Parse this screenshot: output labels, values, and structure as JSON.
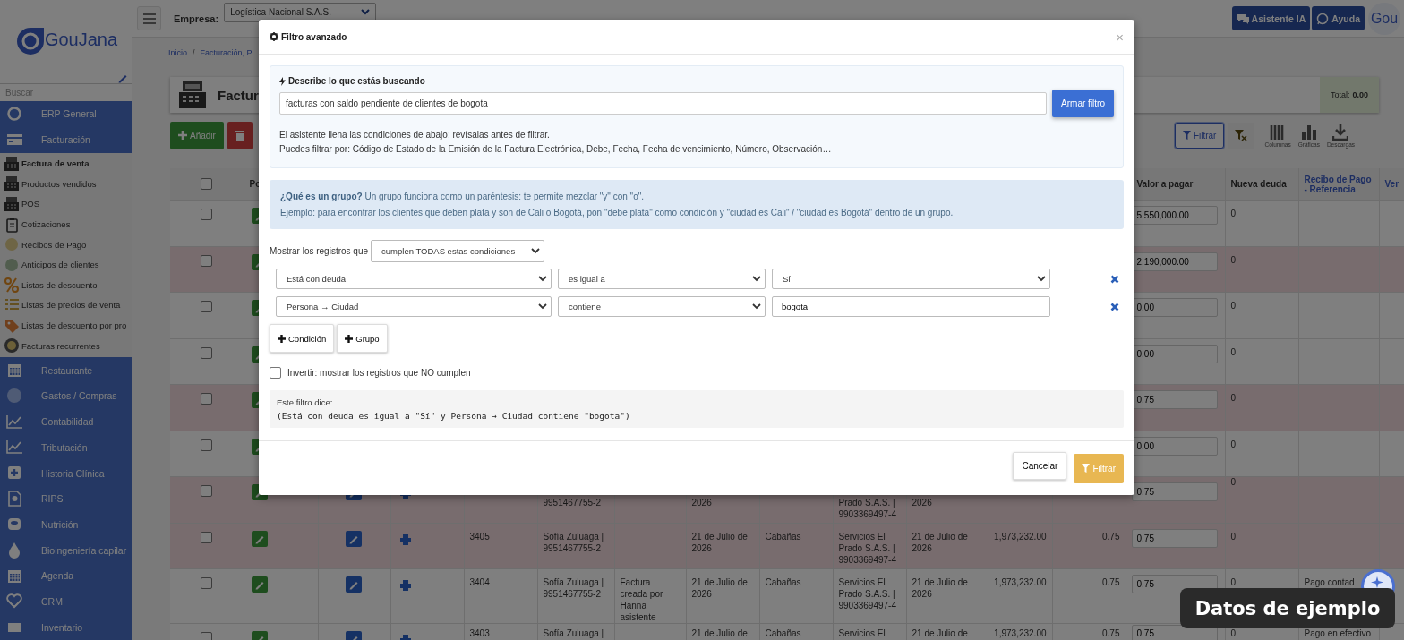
{
  "topbar": {
    "company_label": "Empresa:",
    "company": "Logística Nacional S.A.S.",
    "buttons": [
      "Asistente IA",
      "Ayuda"
    ],
    "avatar": "Gou"
  },
  "sidebar": {
    "logo": "GouJana",
    "search": {
      "placeholder": "Buscar"
    },
    "items": [
      {
        "label": "ERP General",
        "selected": false
      },
      {
        "label": "Facturación",
        "selected": false,
        "expanded": true,
        "children": [
          {
            "label": "Factura de venta",
            "selected": true
          },
          {
            "label": "Productos vendidos",
            "selected": false
          },
          {
            "label": "POS",
            "selected": false
          },
          {
            "label": "Cotizaciones",
            "selected": false
          },
          {
            "label": "Recibos de Pago",
            "selected": false
          },
          {
            "label": "Anticipos de clientes",
            "selected": false
          },
          {
            "label": "Listas de descuento",
            "selected": false
          },
          {
            "label": "Listas de precios de venta",
            "selected": false
          },
          {
            "label": "Listas de descuento por pro",
            "selected": false
          },
          {
            "label": "Facturas recurrentes",
            "selected": false
          }
        ]
      },
      {
        "label": "Restaurante",
        "selected": false
      },
      {
        "label": "Gastos / Compras",
        "selected": false
      },
      {
        "label": "Contabilidad",
        "selected": false
      },
      {
        "label": "Tributación",
        "selected": false
      },
      {
        "label": "Historia Clínica",
        "selected": false
      },
      {
        "label": "RIPS",
        "selected": false
      },
      {
        "label": "Nutrición",
        "selected": false
      },
      {
        "label": "Bioingeniería capilar",
        "selected": false
      },
      {
        "label": "Agenda",
        "selected": false
      },
      {
        "label": "CRM",
        "selected": false
      },
      {
        "label": "Inventario",
        "selected": false
      }
    ]
  },
  "breadcrumb": {
    "items": [
      "Inicio",
      "Facturación, P"
    ],
    "separator": "/"
  },
  "page": {
    "title": "Factur",
    "total_label": "Total:",
    "total": "0.00"
  },
  "toolbar": {
    "add": "Añadir",
    "filter": {
      "label": "Filtrar",
      "active": true
    },
    "tools": [
      "Columnas",
      "Gráficas",
      "Descargas"
    ]
  },
  "table": {
    "select_all_checked": false,
    "header_left": "Po",
    "header_right": [
      "Valor a pagar",
      "Nueva deuda",
      "Recibo de Pago - Referencia",
      "Ver"
    ],
    "rows": [
      {
        "highlighted": false,
        "checked": false,
        "column_14": "5,550,000.00",
        "column_15": "0"
      },
      {
        "highlighted": true,
        "checked": false,
        "column_14": "2,190,000.00",
        "column_15": "0"
      },
      {
        "highlighted": false,
        "checked": false,
        "column_14": "0.00",
        "column_15": "0"
      },
      {
        "highlighted": false,
        "checked": false,
        "column_14": "0.00",
        "column_15": "0"
      },
      {
        "highlighted": true,
        "checked": false,
        "column_14": "0.75",
        "column_15": "0"
      },
      {
        "highlighted": false,
        "checked": false,
        "column_14": "0.00",
        "column_15": "0"
      },
      {
        "highlighted": true,
        "checked": false,
        "column_6": "9951467755-2",
        "column_8": "2026",
        "column_10": "Prado S.A.S. | 9903369497-4",
        "column_11": "2026",
        "column_14": "0.75",
        "column_15": "0"
      },
      {
        "highlighted": true,
        "checked": false,
        "column_5": "3405",
        "column_6": "Sofía Zuluaga | 9951467755-2",
        "column_8": "21 de Julio de 2026",
        "column_9": "Cabañas",
        "column_10": "Servicios El Prado S.A.S. | 9903369497-4",
        "column_11": "21 de Julio de 2026",
        "column_12": "1,973,232.00",
        "column_13": "0.75",
        "column_14": "0.75",
        "column_15": "0"
      },
      {
        "highlighted": false,
        "checked": false,
        "column_5": "3404",
        "column_6": "Sofía Zuluaga | 9951467755-2",
        "column_7": "Factura creada por Hanna asistente",
        "column_8": "21 de Julio de 2026",
        "column_9": "Cabañas",
        "column_10": "Servicios El Prado S.A.S. | 9903369497-4",
        "column_11": "21 de Julio de 2026",
        "column_12": "1,973,232.00",
        "column_13": "0.75",
        "column_14": "0.75",
        "column_15": "0",
        "column_16": "Pago contad"
      },
      {
        "highlighted": false,
        "checked": false,
        "column_5": "3403",
        "column_6": "Sofía Zuluaga |",
        "column_8": "21 de Julio de",
        "column_9": "Cabañas",
        "column_10": "Servicios El",
        "column_11": "21 de Julio de",
        "column_12": "1,973,232.00",
        "column_13": "0.75",
        "column_14": "0.75",
        "column_15": "0",
        "column_16": "Pago en efectivo"
      }
    ]
  },
  "modal": {
    "title": "Filtro avanzado",
    "close": "×",
    "assistant": {
      "title": "Describe lo que estás buscando",
      "input": "facturas con saldo pendiente de clientes de bogota",
      "button": "Armar filtro",
      "notes": [
        "El asistente llena las condiciones de abajo; revísalas antes de filtrar.",
        "Puedes filtrar por: Código de Estado de la Emisión de la Factura Electrónica, Debe, Fecha, Fecha de vencimiento, Número, Observación…"
      ]
    },
    "info": [
      "**¿Qué es un grupo?** Un grupo funciona como un paréntesis: te permite mezclar \"y\" con \"o\".",
      "Ejemplo: para encontrar los clientes que deben plata y son de Cali o Bogotá, pon \"debe plata\" como condición y \"ciudad es Cali\" / \"ciudad es Bogotá\" dentro de un grupo."
    ],
    "match_label": "Mostrar los registros que",
    "match": "cumplen TODAS estas condiciones",
    "conditions": [
      {
        "field": "Está con deuda",
        "operator": "es igual a",
        "value": "Sí",
        "kind": "select"
      },
      {
        "field": "Persona → Ciudad",
        "operator": "contiene",
        "value": "bogota",
        "kind": "text"
      }
    ],
    "add_buttons": [
      "Condición",
      "Grupo"
    ],
    "invert": {
      "label": "Invertir: mostrar los registros que NO cumplen",
      "checked": false
    },
    "summary": {
      "label": "Este filtro dice:",
      "text": "(Está con deuda es igual a \"Sí\" y Persona → Ciudad contiene \"bogota\")"
    },
    "footer": {
      "cancel": "Cancelar",
      "submit": "Filtrar"
    }
  },
  "notice": "Datos de ejemplo"
}
